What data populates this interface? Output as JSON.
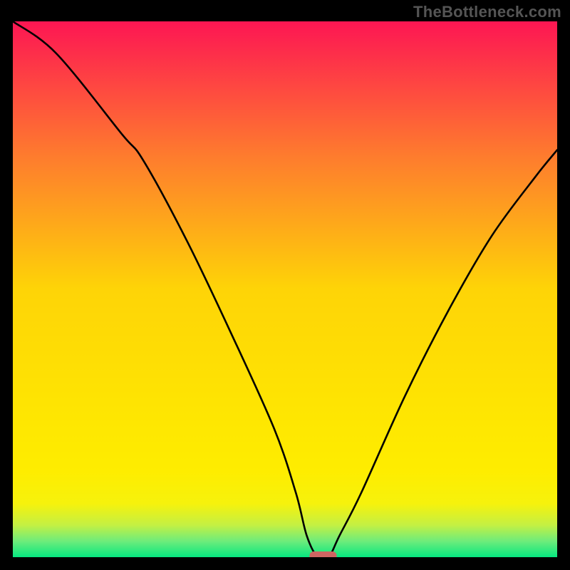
{
  "watermark": "TheBottleneck.com",
  "chart_data": {
    "type": "line",
    "title": "",
    "xlabel": "",
    "ylabel": "",
    "xlim": [
      0,
      100
    ],
    "ylim": [
      0,
      100
    ],
    "grid": false,
    "legend": false,
    "series": [
      {
        "name": "bottleneck-curve",
        "x": [
          0,
          8,
          20,
          24,
          32,
          40,
          48,
          52,
          54,
          56,
          58,
          60,
          64,
          72,
          80,
          88,
          96,
          100
        ],
        "values": [
          100,
          94,
          79,
          74,
          59,
          42,
          24,
          12,
          4,
          0,
          0,
          4,
          12,
          30,
          46,
          60,
          71,
          76
        ]
      }
    ],
    "marker": {
      "name": "optimal-range",
      "shape": "pill",
      "x_range": [
        54.5,
        59.5
      ],
      "y": 0,
      "color": "#ce6562"
    },
    "background_gradient": {
      "top_rgb": [
        253,
        22,
        83
      ],
      "mid_rgb": [
        254,
        231,
        1
      ],
      "bottom_rgb": [
        6,
        232,
        128
      ],
      "stops_y_pct": [
        0,
        25,
        50,
        75,
        84,
        90,
        94,
        97,
        100
      ],
      "stops_color": [
        "#fd1653",
        "#fe7b2e",
        "#fed407",
        "#fee701",
        "#feed00",
        "#f6f20c",
        "#c4f043",
        "#6eec7b",
        "#06e880"
      ]
    }
  }
}
